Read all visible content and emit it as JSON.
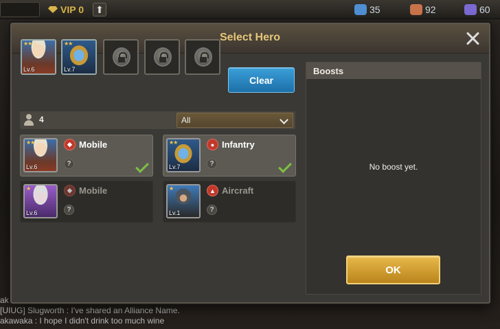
{
  "topbar": {
    "vip_label": "VIP 0",
    "resources": [
      {
        "icon": "crystal-icon",
        "value": "35",
        "color": "#4f8fd1"
      },
      {
        "icon": "meat-icon",
        "value": "92",
        "color": "#c9734a"
      },
      {
        "icon": "energy-icon",
        "value": "60",
        "color": "#7a6ad1"
      }
    ]
  },
  "chat": {
    "lines": [
      {
        "sender": "akawaka",
        "text": ""
      },
      {
        "sender": "[UIUG] Slugworth",
        "text": "I've shared an Alliance Name."
      },
      {
        "sender": "akawaka",
        "text": "I hope I didn't drink too much wine"
      }
    ]
  },
  "modal": {
    "title": "Select Hero",
    "clear_label": "Clear",
    "ok_label": "OK",
    "hero_count": "4",
    "filter_value": "All",
    "slots": [
      {
        "state": "hero",
        "portrait": "blond-soldier",
        "level": "Lv.6",
        "stars": "★★☆"
      },
      {
        "state": "hero",
        "portrait": "robot-shield",
        "level": "Lv.7",
        "stars": "★★"
      },
      {
        "state": "locked"
      },
      {
        "state": "locked"
      },
      {
        "state": "locked"
      }
    ],
    "heroes": [
      {
        "type": "Mobile",
        "level": "Lv.6",
        "stars": "★★",
        "selected": true,
        "portrait": "blond-soldier",
        "type_icon": "mobile-icon"
      },
      {
        "type": "Infantry",
        "level": "Lv.7",
        "stars": "★★",
        "selected": true,
        "portrait": "robot-shield",
        "type_icon": "infantry-icon"
      },
      {
        "type": "Mobile",
        "level": "Lv.6",
        "stars": "★",
        "selected": false,
        "portrait": "silver-hair-woman",
        "type_icon": "mobile-icon"
      },
      {
        "type": "Aircraft",
        "level": "Lv.1",
        "stars": "★",
        "selected": false,
        "portrait": "pilot",
        "type_icon": "aircraft-icon"
      }
    ],
    "boosts": {
      "header": "Boosts",
      "empty_text": "No boost yet."
    }
  },
  "colors": {
    "accent_gold": "#e6c77a",
    "clear_blue": "#2a88c4",
    "ok_gold": "#d8a234",
    "check_green": "#7cc142"
  }
}
